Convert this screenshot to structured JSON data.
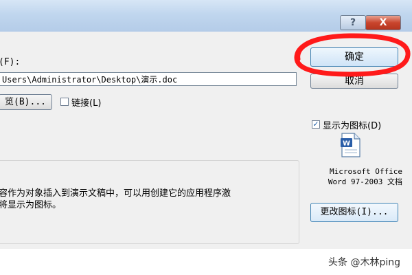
{
  "title_bar": {
    "help_label": "?",
    "close_label": "X"
  },
  "file_label": "(F):",
  "file_path": "Users\\Administrator\\Desktop\\演示.doc",
  "buttons": {
    "ok": "确定",
    "cancel": "取消",
    "browse": "览(B)...",
    "change_icon": "更改图标(I)..."
  },
  "link_checkbox": {
    "label": "链接(L)",
    "checked": false
  },
  "display_as_icon": {
    "label": "显示为图标(D)",
    "checked": true
  },
  "icon_caption": "Microsoft Office\nWord 97-2003 文档",
  "result_text": "容作为对象插入到演示文稿中，可以用创建它的应用程序激\n将显示为图标。",
  "watermark": "头条 @木林ping",
  "colors": {
    "annotation_circle": "#ff1a1a",
    "checkbox_check": "#1f5fa8"
  },
  "icons": {
    "word_document": "word-document-icon"
  }
}
